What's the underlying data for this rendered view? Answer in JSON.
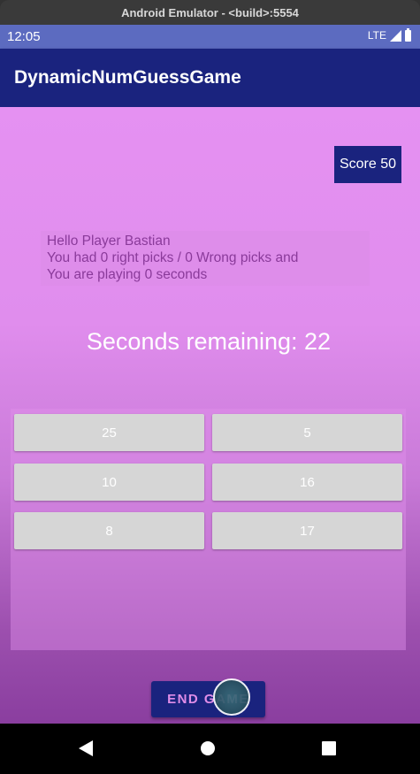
{
  "emulator": {
    "window_title": "Android Emulator - <build>:5554"
  },
  "statusbar": {
    "time": "12:05",
    "network": "LTE"
  },
  "appbar": {
    "title": "DynamicNumGuessGame"
  },
  "score": {
    "label": "Score 50"
  },
  "info": {
    "line1": "Hello Player Bastian",
    "line2": "You had 0 right picks / 0 Wrong picks and",
    "line3": "You are playing 0 seconds"
  },
  "timer": {
    "text": "Seconds remaining: 22"
  },
  "number_buttons": [
    {
      "label": "25"
    },
    {
      "label": "5"
    },
    {
      "label": "10"
    },
    {
      "label": "16"
    },
    {
      "label": "8"
    },
    {
      "label": "17"
    }
  ],
  "end_button": {
    "label": "END GAME"
  },
  "colors": {
    "primary_dark": "#1a237e",
    "status_bar": "#5c6bc0",
    "background_top": "#e591f2",
    "background_bottom": "#8a3e9f",
    "number_button": "#d6d6d6"
  }
}
